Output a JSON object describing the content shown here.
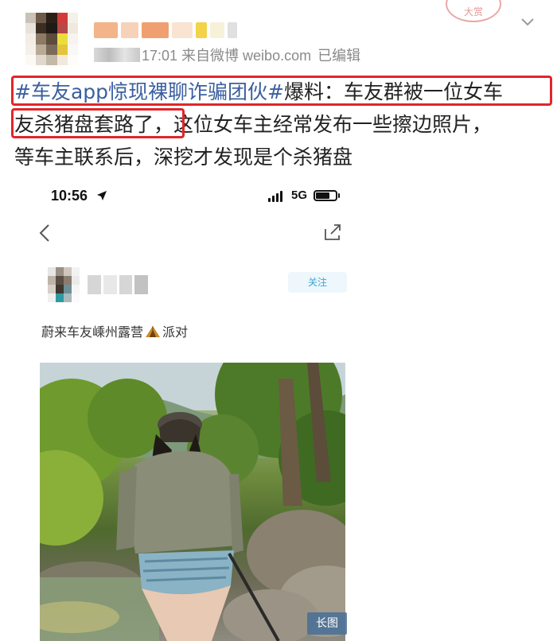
{
  "post": {
    "meta_source": "17:01 来自微博 weibo.com",
    "edited": "已编辑",
    "stamp_text": "大赏",
    "text_line1_hashtag": "#车友app惊现裸聊诈骗团伙#",
    "text_line1_rest": "爆料：车友群被一位女车",
    "text_line2_boxed": "友杀猪盘套路了，",
    "text_line2_rest": "这位女车主经常发布一些擦边照片，",
    "text_line3": "等车主联系后，深挖才发现是个杀猪盘"
  },
  "embedded": {
    "time": "10:56",
    "network": "5G",
    "follow_label": "关注",
    "caption_before": "蔚来车友嵊州露营",
    "caption_after": "派对",
    "long_image_label": "长图"
  },
  "colors": {
    "highlight_box": "#e0262a",
    "hashtag": "#3b5fa0",
    "follow": "#3aa6d8"
  }
}
